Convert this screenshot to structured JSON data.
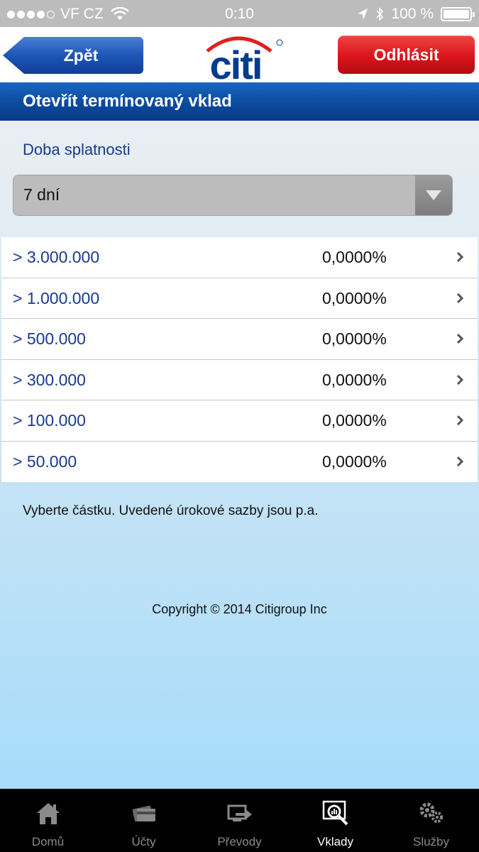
{
  "status_bar": {
    "carrier": "VF CZ",
    "time": "0:10",
    "battery": "100 %",
    "battery_level": 1.0
  },
  "header": {
    "back_label": "Zpět",
    "logo_text": "citi",
    "logout_label": "Odhlásit",
    "colors": {
      "back": "#1e56b8",
      "logout": "#d9141b",
      "logo_blue": "#003b8e",
      "logo_red": "#e02020"
    }
  },
  "page": {
    "title": "Otevřít termínovaný vklad",
    "maturity_label": "Doba splatnosti",
    "maturity_value": "7 dní",
    "rates": [
      {
        "amount": "> 3.000.000",
        "rate": "0,0000%"
      },
      {
        "amount": "> 1.000.000",
        "rate": "0,0000%"
      },
      {
        "amount": "> 500.000",
        "rate": "0,0000%"
      },
      {
        "amount": "> 300.000",
        "rate": "0,0000%"
      },
      {
        "amount": "> 100.000",
        "rate": "0,0000%"
      },
      {
        "amount": "> 50.000",
        "rate": "0,0000%"
      }
    ],
    "hint": "Vyberte částku. Uvedené úrokové sazby jsou p.a.",
    "copyright": "Copyright © 2014 Citigroup Inc"
  },
  "tabs": [
    {
      "label": "Domů",
      "icon": "home-icon"
    },
    {
      "label": "Účty",
      "icon": "card-icon"
    },
    {
      "label": "Převody",
      "icon": "transfer-icon"
    },
    {
      "label": "Vklady",
      "icon": "deposit-chart-icon",
      "active": true
    },
    {
      "label": "Služby",
      "icon": "gears-icon"
    }
  ]
}
